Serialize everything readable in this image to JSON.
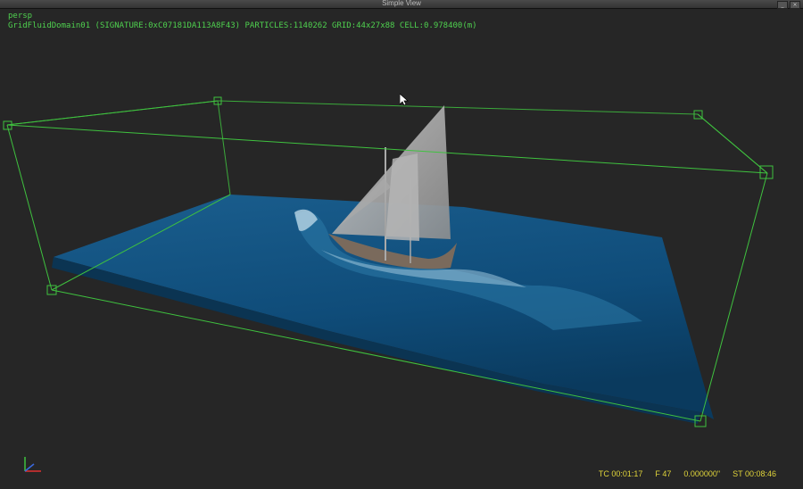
{
  "window": {
    "title": "Simple View"
  },
  "viewport": {
    "camera": "persp",
    "domain_info": "GridFluidDomain01 (SIGNATURE:0xC07181DA113A8F43) PARTICLES:1140262 GRID:44x27x88 CELL:0.978400(m)"
  },
  "timeline": {
    "tc": "TC 00:01:17",
    "frame": "F 47",
    "value": "0.000000\"",
    "st": "ST 00:08:46"
  },
  "colors": {
    "bbox": "#3fc23f",
    "water": "#0f4c79",
    "hud_text": "#4fd14f",
    "timecode": "#e0d43a"
  },
  "icons": {
    "axis": "axis-gizmo-icon",
    "cursor": "mouse-cursor-icon"
  }
}
